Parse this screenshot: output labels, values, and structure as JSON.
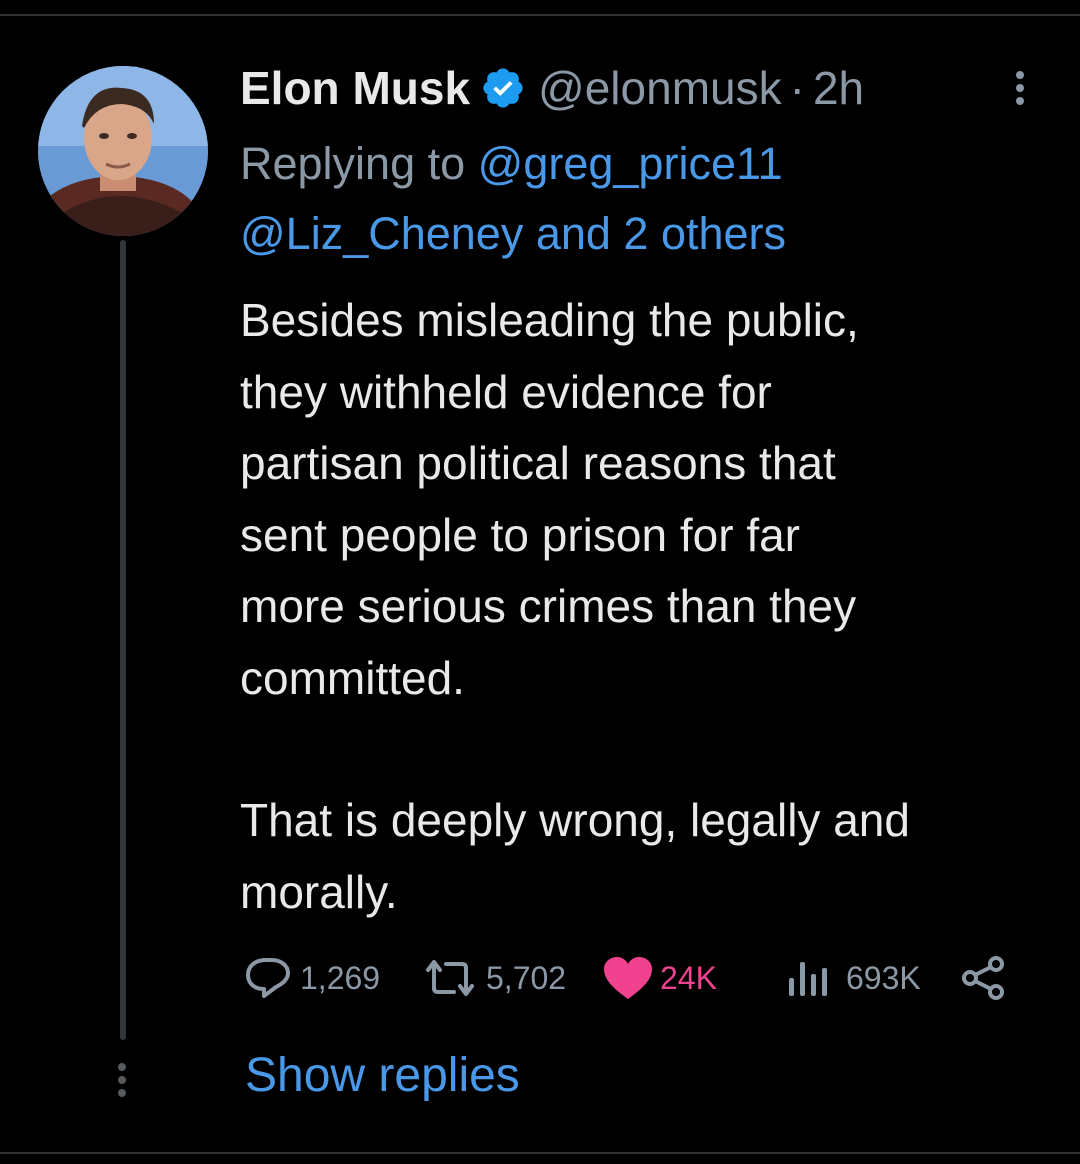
{
  "tweet": {
    "display_name": "Elon Musk",
    "handle": "@elonmusk",
    "separator": "·",
    "time": "2h",
    "replying_prefix": "Replying to",
    "reply_to_1": "@greg_price11",
    "reply_to_2": "@Liz_Cheney and 2 others",
    "body_lines_1": [
      "Besides misleading the public,",
      "they withheld evidence for",
      "partisan political reasons that",
      "sent people to prison for far",
      "more serious crimes than they",
      "committed."
    ],
    "body_lines_2": [
      "That is deeply wrong, legally and",
      "morally."
    ]
  },
  "actions": {
    "replies": "1,269",
    "reposts": "5,702",
    "likes": "24K",
    "views": "693K"
  },
  "show_replies_label": "Show replies",
  "colors": {
    "background": "#000000",
    "text": "#e7e9ea",
    "muted": "#8b98a5",
    "link": "#4a99e9",
    "like": "#f0428f",
    "verified": "#1d9bf0"
  },
  "icons": [
    "verified-badge-icon",
    "more-icon",
    "reply-icon",
    "repost-icon",
    "like-icon",
    "views-icon",
    "share-icon"
  ]
}
